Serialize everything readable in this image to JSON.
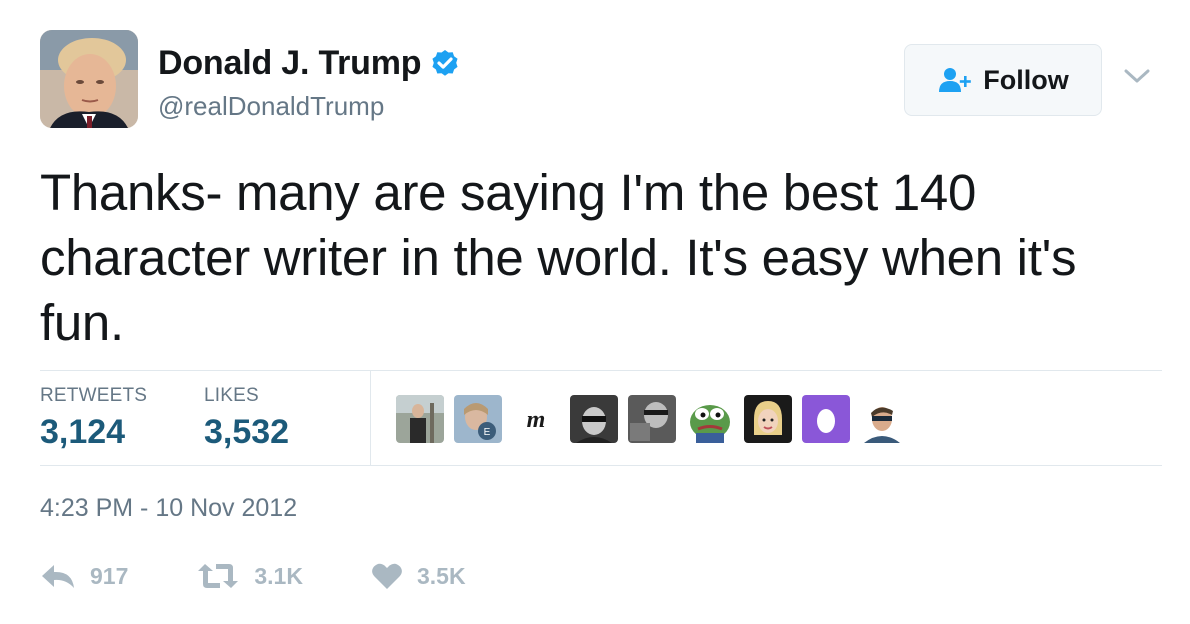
{
  "user": {
    "display_name": "Donald J. Trump",
    "handle": "@realDonaldTrump",
    "verified": true
  },
  "follow_button": {
    "label": "Follow",
    "icon": "add-person-icon"
  },
  "menu_caret": {
    "icon": "chevron-down-icon"
  },
  "tweet": {
    "text": "Thanks- many are saying I'm the best 140 character writer in the world. It's easy when it's fun."
  },
  "stats": {
    "retweets_label": "RETWEETS",
    "retweets_value": "3,124",
    "likes_label": "LIKES",
    "likes_value": "3,532"
  },
  "likers": [
    {
      "icon": "user-avatar-1"
    },
    {
      "icon": "user-avatar-2"
    },
    {
      "icon": "user-avatar-3"
    },
    {
      "icon": "user-avatar-4"
    },
    {
      "icon": "user-avatar-5"
    },
    {
      "icon": "user-avatar-frog"
    },
    {
      "icon": "user-avatar-7"
    },
    {
      "icon": "user-avatar-egg"
    },
    {
      "icon": "user-avatar-9"
    }
  ],
  "timestamp": "4:23 PM - 10 Nov 2012",
  "actions": {
    "reply_count": "917",
    "retweet_count": "3.1K",
    "like_count": "3.5K"
  },
  "colors": {
    "accent": "#1da1f2",
    "stat_value": "#1c5a7a",
    "muted": "#657786",
    "action_gray": "#aab8c2",
    "border": "#e1e8ed"
  }
}
